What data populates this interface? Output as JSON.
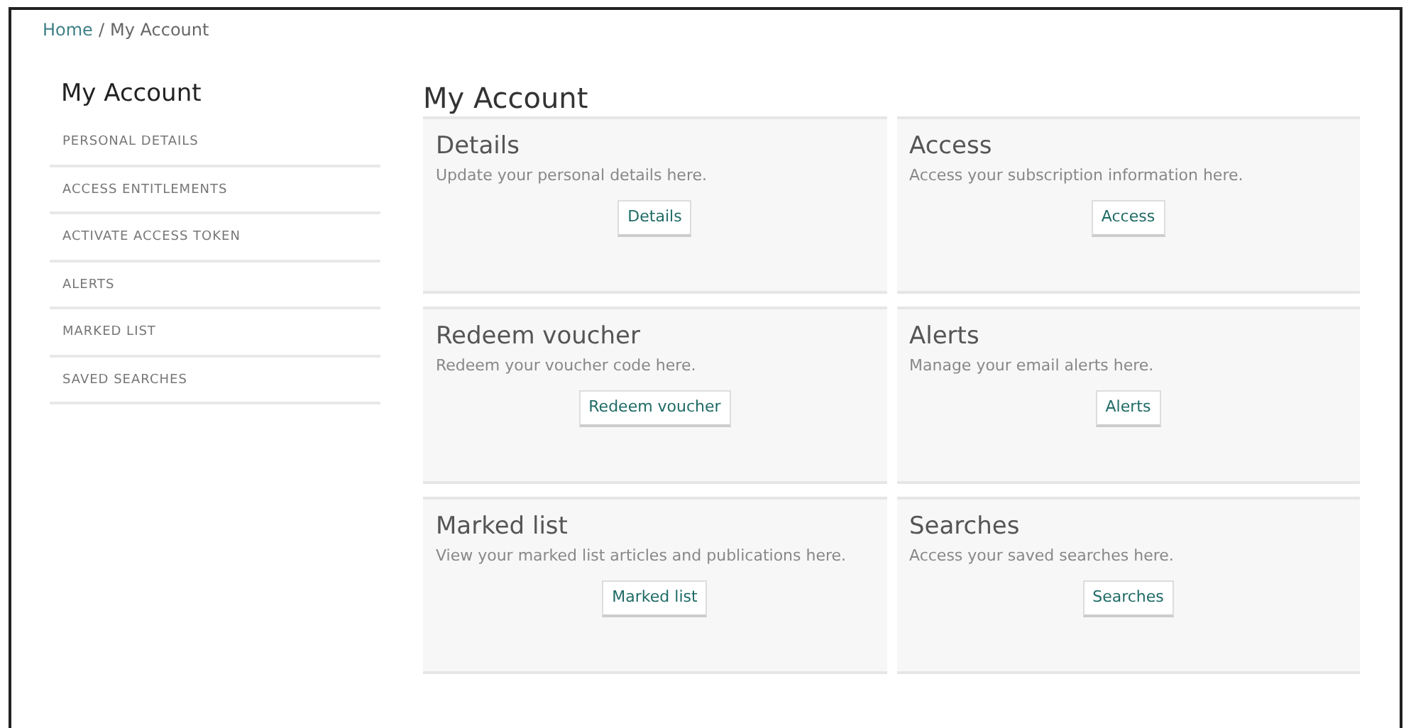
{
  "breadcrumb": {
    "items": [
      "Home",
      "My Account"
    ],
    "separator": "/"
  },
  "sidebar": {
    "title": "My Account",
    "items": [
      {
        "label": "PERSONAL DETAILS"
      },
      {
        "label": "ACCESS ENTITLEMENTS"
      },
      {
        "label": "ACTIVATE ACCESS TOKEN"
      },
      {
        "label": "ALERTS"
      },
      {
        "label": "MARKED LIST"
      },
      {
        "label": "SAVED SEARCHES"
      }
    ]
  },
  "main": {
    "title": "My Account",
    "cards": [
      {
        "title": "Details",
        "description": "Update your personal details here.",
        "button": "Details"
      },
      {
        "title": "Access",
        "description": "Access your subscription information here.",
        "button": "Access"
      },
      {
        "title": "Redeem voucher",
        "description": "Redeem your voucher code here.",
        "button": "Redeem voucher"
      },
      {
        "title": "Alerts",
        "description": "Manage your email alerts here.",
        "button": "Alerts"
      },
      {
        "title": "Marked list",
        "description": "View your marked list articles and publications here.",
        "button": "Marked list"
      },
      {
        "title": "Searches",
        "description": "Access your saved searches here.",
        "button": "Searches"
      }
    ]
  }
}
